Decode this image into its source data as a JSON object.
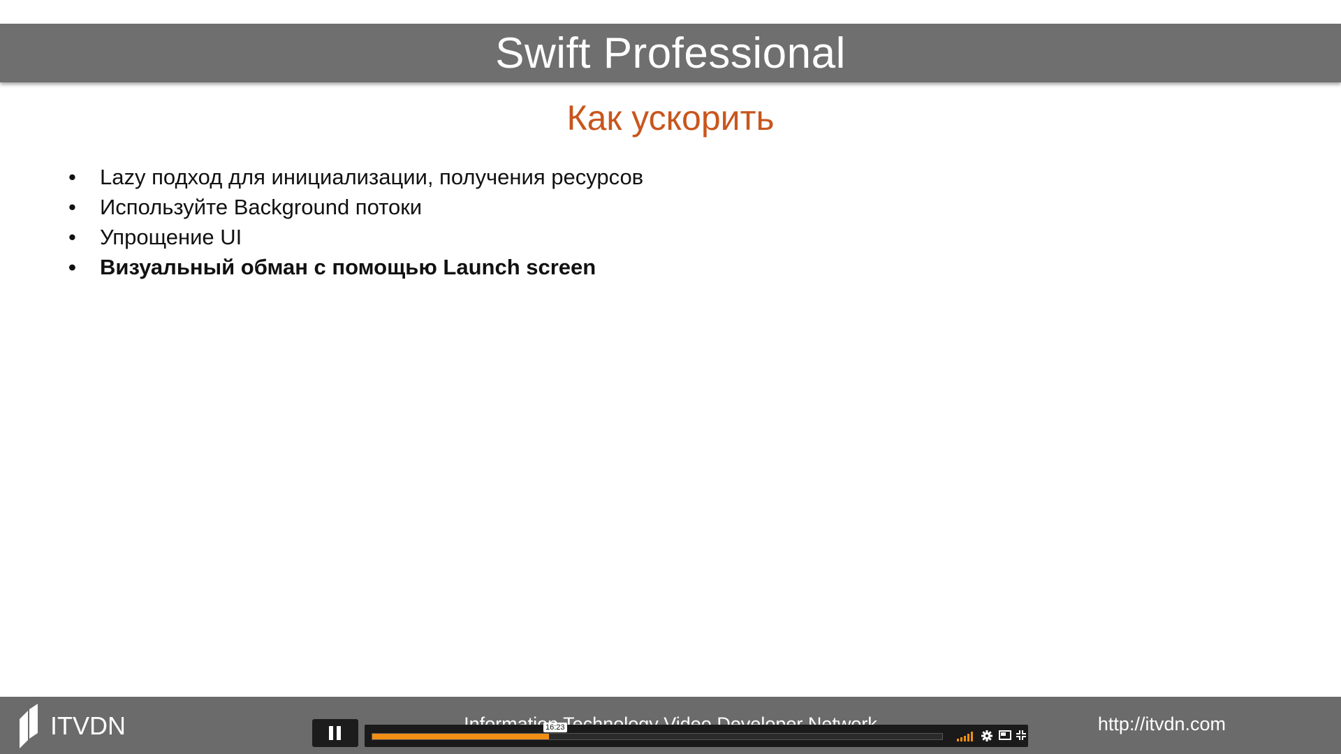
{
  "slide": {
    "title": "Swift Professional",
    "subtitle": "Как ускорить",
    "bullets": [
      {
        "text": "Lazy подход для инициализации, получения ресурсов",
        "bold": false
      },
      {
        "text": "Используйте Background потоки",
        "bold": false
      },
      {
        "text": "Упрощение UI",
        "bold": false
      },
      {
        "text": "Визуальный обман с помощью Launch screen",
        "bold": true
      }
    ],
    "bullet_glyph": "•"
  },
  "footer": {
    "logo_text": "ITVDN",
    "center_text": "Information Technology Video Developer Network",
    "url": "http://itvdn.com"
  },
  "player": {
    "current_time": "16:23",
    "progress": 0.31,
    "volume_level": 1.0,
    "accent_color": "#f08f14",
    "icons": [
      "pause-icon",
      "volume-icon",
      "settings-gear-icon",
      "picture-in-picture-icon",
      "fullscreen-icon"
    ]
  },
  "colors": {
    "title_bar": "#6f6f6f",
    "subtitle": "#c8561d",
    "footer": "#6b6b6b"
  }
}
